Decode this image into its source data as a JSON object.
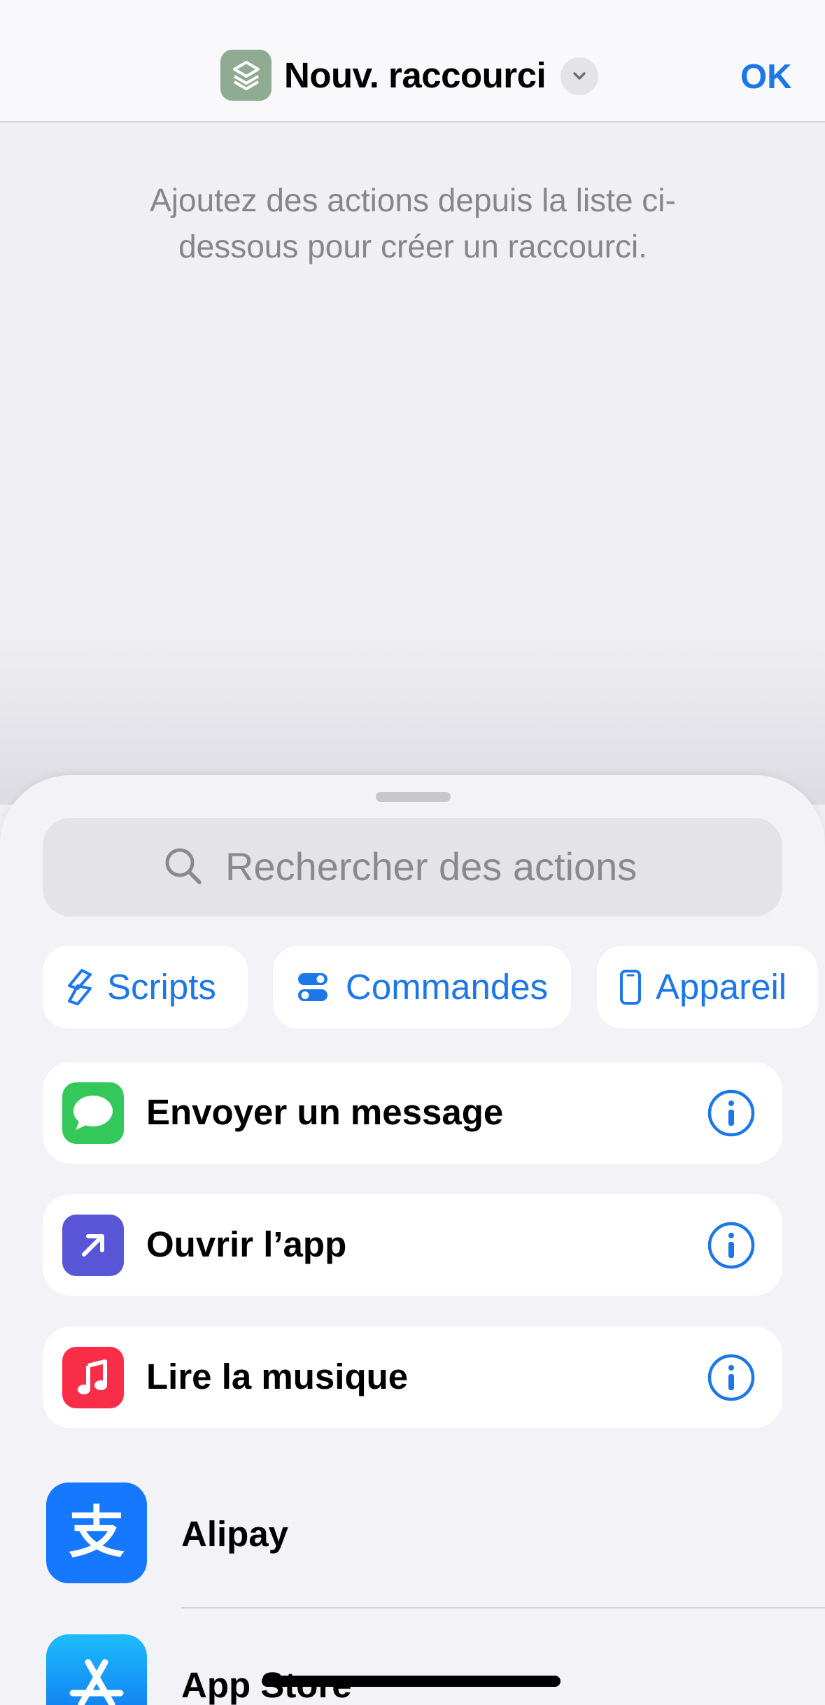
{
  "nav": {
    "app_icon": "shortcuts-icon",
    "title": "Nouv. raccourci",
    "chevron_icon": "chevron-down-icon",
    "done_label": "OK"
  },
  "editor": {
    "empty_hint": "Ajoutez des actions depuis la liste ci-dessous pour créer un raccourci."
  },
  "sheet": {
    "search": {
      "icon": "magnifying-glass-icon",
      "placeholder": "Rechercher des actions"
    },
    "categories": [
      {
        "label": "Scripts",
        "icon": "scripts-icon"
      },
      {
        "label": "Commandes",
        "icon": "toggles-icon"
      },
      {
        "label": "Appareil",
        "icon": "phone-icon"
      }
    ],
    "suggestions": [
      {
        "label": "Envoyer un message",
        "icon": "messages-icon",
        "color": "#34c759"
      },
      {
        "label": "Ouvrir l’app",
        "icon": "arrow-up-right-icon",
        "color": "#5856d6"
      },
      {
        "label": "Lire la musique",
        "icon": "music-note-icon",
        "color": "#fa2d48"
      }
    ],
    "apps": [
      {
        "label": "Alipay",
        "icon": "alipay-icon",
        "color": "#1677ff"
      },
      {
        "label": "App Store",
        "icon": "app-store-icon",
        "color": "#0d84ff"
      }
    ]
  },
  "colors": {
    "accent": "#1c77e8",
    "background": "#efeff4"
  }
}
